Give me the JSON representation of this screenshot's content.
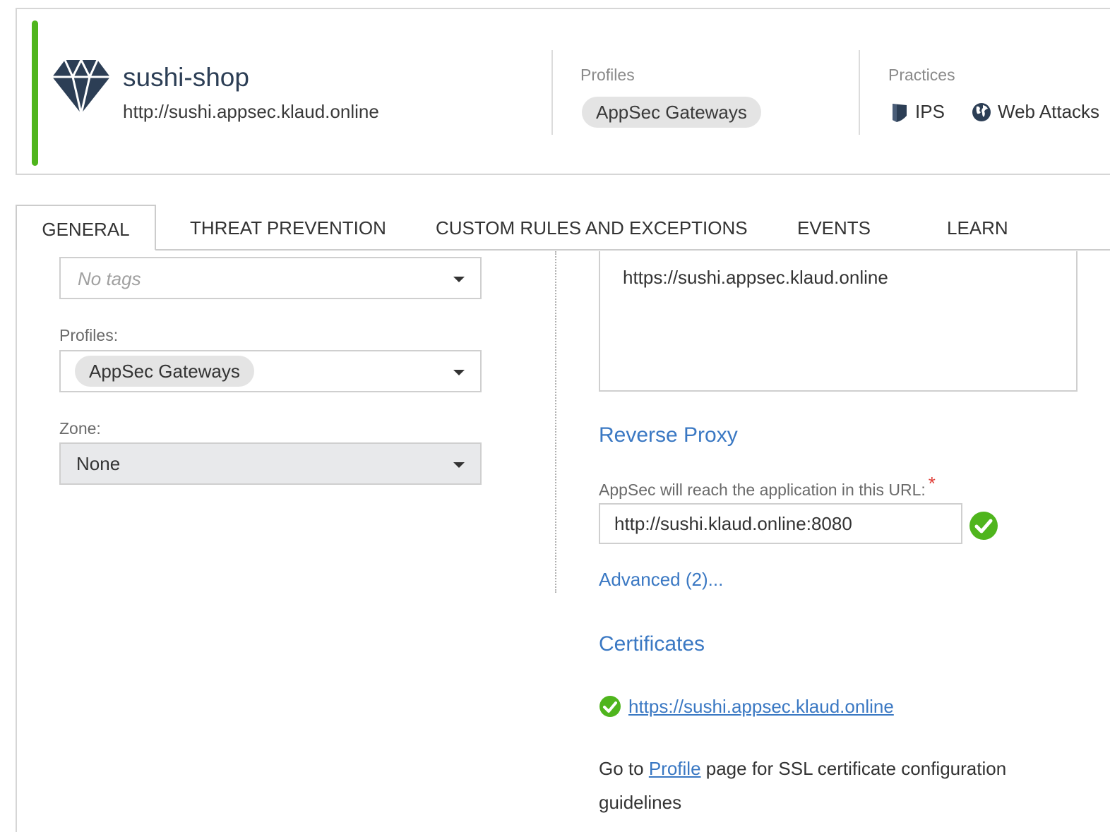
{
  "asset": {
    "name": "sushi-shop",
    "url": "http://sushi.appsec.klaud.online",
    "icon": "gem-icon"
  },
  "profiles": {
    "label": "Profiles",
    "chip": "AppSec Gateways"
  },
  "practices": {
    "label": "Practices",
    "items": [
      {
        "label": "IPS",
        "icon": "shield-icon"
      },
      {
        "label": "Web Attacks",
        "icon": "globe-icon"
      }
    ]
  },
  "tabs": [
    {
      "label": "GENERAL",
      "active": true
    },
    {
      "label": "THREAT PREVENTION",
      "active": false
    },
    {
      "label": "CUSTOM RULES AND EXCEPTIONS",
      "active": false
    },
    {
      "label": "EVENTS",
      "active": false
    },
    {
      "label": "LEARN",
      "active": false
    }
  ],
  "form": {
    "tags": {
      "placeholder": "No tags"
    },
    "profiles": {
      "label": "Profiles:",
      "value": "AppSec Gateways"
    },
    "zone": {
      "label": "Zone:",
      "value": "None"
    }
  },
  "right": {
    "urls_value": "https://sushi.appsec.klaud.online",
    "reverse_proxy": {
      "title": "Reverse Proxy",
      "label": "AppSec will reach the application in this URL:",
      "required_mark": "*",
      "value": "http://sushi.klaud.online:8080",
      "advanced_link": "Advanced (2)..."
    },
    "certificates": {
      "title": "Certificates",
      "link": "https://sushi.appsec.klaud.online",
      "help_prefix": "Go to",
      "help_link": "Profile",
      "help_suffix": "page for SSL certificate configuration guidelines"
    }
  },
  "colors": {
    "status": "#4fb51d",
    "accent": "#3a78c3",
    "check": "#4fb51d"
  }
}
